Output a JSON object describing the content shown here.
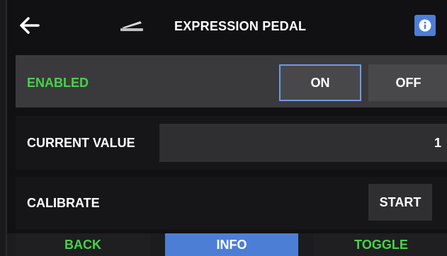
{
  "header": {
    "back_icon": "arrow-left-icon",
    "pedal_icon": "expression-pedal-icon",
    "title": "EXPRESSION PEDAL",
    "info_icon": "info-icon"
  },
  "rows": {
    "enabled": {
      "label": "ENABLED",
      "on_label": "ON",
      "off_label": "OFF",
      "selected": "ON"
    },
    "current_value": {
      "label": "CURRENT VALUE",
      "value": "1"
    },
    "calibrate": {
      "label": "CALIBRATE",
      "button_label": "START"
    }
  },
  "bottom_bar": {
    "back_label": "BACK",
    "info_label": "INFO",
    "toggle_label": "TOGGLE"
  },
  "colors": {
    "accent_blue": "#4d7ed6",
    "active_green": "#48d248",
    "selected_border": "#6f9ae6"
  }
}
